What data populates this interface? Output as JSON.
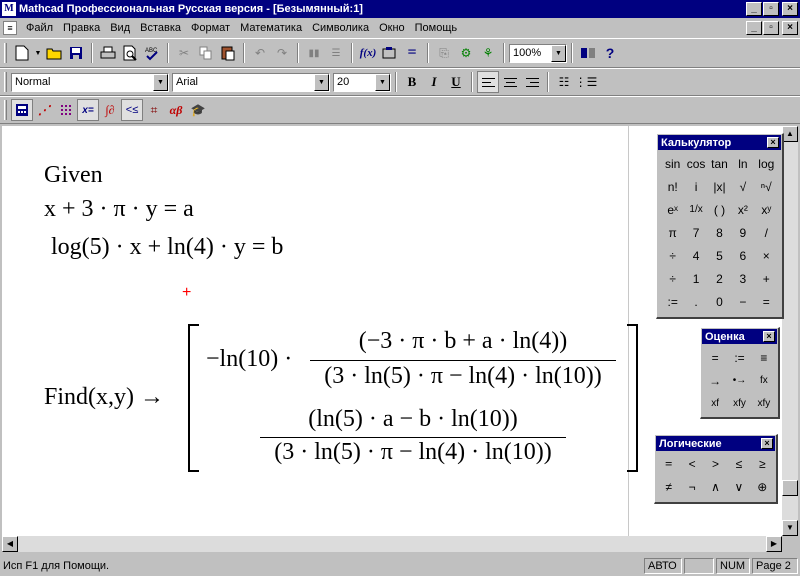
{
  "window": {
    "title": "Mathcad Профессиональная Русская версия - [Безымянный:1]",
    "min": "_",
    "max": "▫",
    "close": "×"
  },
  "menu": {
    "items": [
      "Файл",
      "Правка",
      "Вид",
      "Вставка",
      "Формат",
      "Математика",
      "Символика",
      "Окно",
      "Помощь"
    ]
  },
  "format_bar": {
    "style": "Normal",
    "font": "Arial",
    "size": "20",
    "bold": "B",
    "italic": "I",
    "underline": "U"
  },
  "standard_bar": {
    "zoom": "100%",
    "fx": "f(x)",
    "equals": "="
  },
  "worksheet": {
    "given": "Given",
    "eq1": "x + 3 · π · y = a",
    "eq2": "log(5) · x + ln(4) · y = b",
    "find_call": "Find(x,y) →",
    "r1_prefix": "−ln(10) ·",
    "r1_num": "(−3 · π · b + a · ln(4))",
    "r1_den": "(3 · ln(5) · π − ln(4) · ln(10))",
    "r2_num": "(ln(5) · a − b · ln(10))",
    "r2_den": "(3 · ln(5) · π − ln(4) · ln(10))",
    "cursor": "+"
  },
  "calc_palette": {
    "title": "Калькулятор",
    "buttons": [
      "sin",
      "cos",
      "tan",
      "ln",
      "log",
      "n!",
      "i",
      "|x|",
      "√",
      "ⁿ√",
      "eˣ",
      "1/x",
      "( )",
      "x²",
      "xʸ",
      "π",
      "7",
      "8",
      "9",
      "/",
      "÷",
      "4",
      "5",
      "6",
      "×",
      "÷",
      "1",
      "2",
      "3",
      "+",
      ":=",
      ".",
      "0",
      "−",
      "="
    ]
  },
  "eval_palette": {
    "title": "Оценка",
    "buttons": [
      "=",
      ":=",
      "≡",
      "→",
      "•→",
      "fx",
      "xf",
      "xfy",
      "xfy"
    ]
  },
  "logic_palette": {
    "title": "Логические",
    "buttons": [
      "=",
      "<",
      ">",
      "≤",
      "≥",
      "≠",
      "¬",
      "∧",
      "∨",
      "⊕"
    ]
  },
  "status": {
    "message": "Исп F1 для Помощи.",
    "mode": "АВТО",
    "num": "NUM",
    "page": "Page 2"
  },
  "colors": {
    "title_bg": "#000080",
    "face": "#c0c0c0",
    "cursor": "#ff0000"
  }
}
